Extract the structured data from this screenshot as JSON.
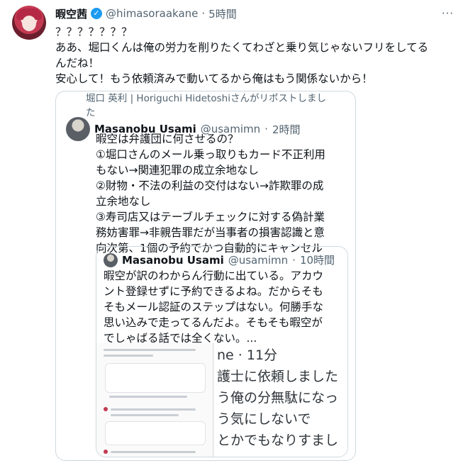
{
  "tweet": {
    "display_name": "暇空茜",
    "handle": "@himasoraakane",
    "separator": "·",
    "time": "5時間",
    "more": "···",
    "lines": [
      "？？？？？？？",
      "ああ、堀口くんは俺の労力を削りたくてわざと乗り気じゃないフリをしてる",
      "んだね！",
      "安心して！もう依頼済みで動いてるから俺はもう関係ないから！"
    ]
  },
  "quote": {
    "repost_line": "堀口 英利 | Horiguchi Hidetoshiさんがリポストしまし",
    "repost_line2": "た",
    "display_name": "Masanobu Usami",
    "handle": "@usamimn",
    "separator": "·",
    "time": "2時間",
    "lines": [
      "暇空は弁護団に何させるの？",
      "①堀口さんのメール乗っ取りもカード不正利用",
      "もない→関連犯罪の成立余地なし",
      "②財物・不法の利益の交付はない→詐欺罪の成",
      "立余地なし",
      "③寿司店又はテーブルチェックに対する偽計業",
      "務妨害罪→非親告罪だが当事者の損害認識と意",
      "向次第、1個の予約でかつ自動的にキャンセル"
    ]
  },
  "inner_quote": {
    "display_name": "Masanobu Usami",
    "handle": "@usamimn",
    "separator": "·",
    "time": "10時間",
    "lines": [
      "暇空が訳のわからん行動に出ている。アカウ",
      "ント登録せずに予約できるよね。だからそも",
      "そもメール認証のステップはない。何勝手な",
      "思い込みで走ってるんだよ。そもそも暇空が",
      "でしゃばる話では全くない。..."
    ],
    "media_right_lines": [
      "ne · 11分",
      "護士に依頼しました",
      "う俺の分無駄になっ",
      "う気にしないで",
      "とかでもなりすまし"
    ]
  }
}
